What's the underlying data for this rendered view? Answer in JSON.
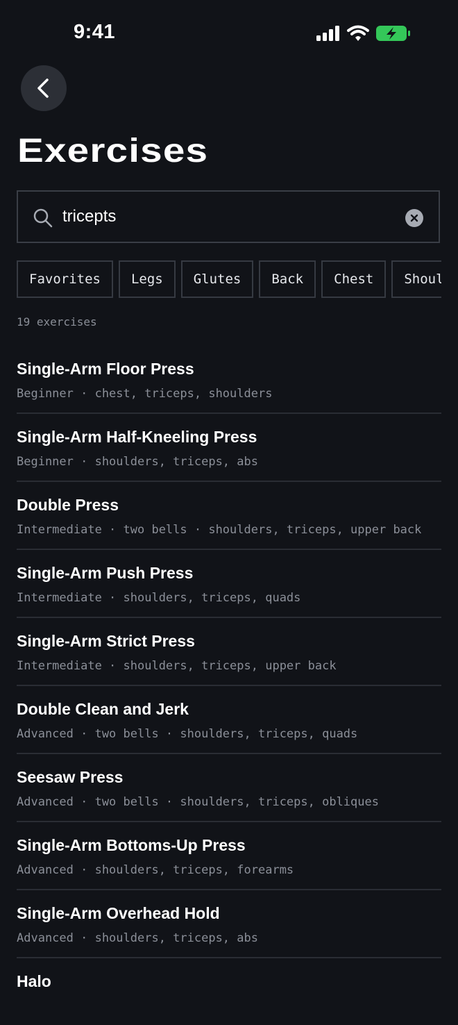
{
  "status_bar": {
    "time": "9:41",
    "icons": [
      "cellular-signal-icon",
      "wifi-icon",
      "battery-charging-icon"
    ],
    "battery_color": "#34c759"
  },
  "header": {
    "back_icon": "chevron-left-icon",
    "title": "Exercises"
  },
  "search": {
    "value": "tricepts",
    "icon": "search-icon",
    "clear_icon": "clear-icon"
  },
  "filters": [
    "Favorites",
    "Legs",
    "Glutes",
    "Back",
    "Chest",
    "Shoulders"
  ],
  "results": {
    "count_label": "19 exercises",
    "items": [
      {
        "title": "Single-Arm Floor Press",
        "subtitle": "Beginner · chest, triceps, shoulders"
      },
      {
        "title": "Single-Arm Half-Kneeling Press",
        "subtitle": "Beginner · shoulders, triceps, abs"
      },
      {
        "title": "Double Press",
        "subtitle": "Intermediate · two bells · shoulders, triceps, upper back"
      },
      {
        "title": "Single-Arm Push Press",
        "subtitle": "Intermediate · shoulders, triceps, quads"
      },
      {
        "title": "Single-Arm Strict Press",
        "subtitle": "Intermediate · shoulders, triceps, upper back"
      },
      {
        "title": "Double Clean and Jerk",
        "subtitle": "Advanced · two bells · shoulders, triceps, quads"
      },
      {
        "title": "Seesaw Press",
        "subtitle": "Advanced · two bells · shoulders, triceps, obliques"
      },
      {
        "title": "Single-Arm Bottoms-Up Press",
        "subtitle": "Advanced · shoulders, triceps, forearms"
      },
      {
        "title": "Single-Arm Overhead Hold",
        "subtitle": "Advanced · shoulders, triceps, abs"
      },
      {
        "title": "Halo",
        "subtitle": ""
      }
    ]
  },
  "colors": {
    "background": "#111318",
    "muted_text": "#8b8f98",
    "divider": "#2a2d34",
    "chip_border": "#363a42"
  }
}
